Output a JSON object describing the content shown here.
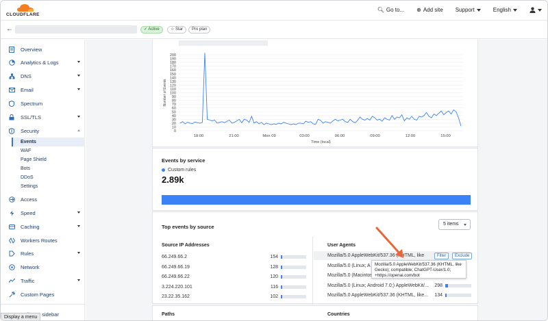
{
  "brand": {
    "name": "CLOUDFLARE",
    "accent": "#f38020",
    "link": "#1e3a66",
    "blue": "#3b82f6"
  },
  "topnav": {
    "goto": "Go to...",
    "add_site": "Add site",
    "support": "Support",
    "language": "English"
  },
  "zone": {
    "status": "Active",
    "star": "Star",
    "plan": "Pro plan"
  },
  "sidebar": {
    "items": [
      {
        "label": "Overview",
        "icon": "document-icon"
      },
      {
        "label": "Analytics & Logs",
        "icon": "analytics-icon"
      },
      {
        "label": "DNS",
        "icon": "dns-icon"
      },
      {
        "label": "Email",
        "icon": "email-icon"
      },
      {
        "label": "Spectrum",
        "icon": "shield-icon"
      },
      {
        "label": "SSL/TLS",
        "icon": "lock-icon"
      },
      {
        "label": "Security",
        "icon": "security-shield-icon"
      },
      {
        "label": "Access",
        "icon": "access-icon"
      },
      {
        "label": "Speed",
        "icon": "speed-icon"
      },
      {
        "label": "Caching",
        "icon": "caching-icon"
      },
      {
        "label": "Workers Routes",
        "icon": "workers-icon"
      },
      {
        "label": "Rules",
        "icon": "rules-icon"
      },
      {
        "label": "Network",
        "icon": "network-icon"
      },
      {
        "label": "Traffic",
        "icon": "traffic-icon"
      },
      {
        "label": "Custom Pages",
        "icon": "wrench-icon"
      }
    ],
    "security_sub": [
      "Events",
      "WAF",
      "Page Shield",
      "Bots",
      "DDoS",
      "Settings"
    ],
    "collapse": "Collapse sidebar"
  },
  "statusbar": "Display a menu",
  "chart_data": {
    "type": "line",
    "title": "",
    "xlabel": "Time (local)",
    "ylabel": "Number of Events",
    "ylim": [
      0,
      200
    ],
    "yticks": [
      0,
      10,
      20,
      30,
      40,
      50,
      60,
      70,
      80,
      90,
      100,
      110,
      120,
      130,
      140,
      150,
      160,
      170,
      180,
      190,
      200
    ],
    "xticks": [
      "18:00",
      "21:00",
      "Mon 09",
      "03:00",
      "06:00",
      "09:00",
      "12:00",
      "15:00"
    ],
    "series": [
      {
        "color": "#3b82f6",
        "values": [
          20,
          24,
          18,
          22,
          20,
          19,
          23,
          21,
          20,
          22,
          205,
          30,
          28,
          26,
          28,
          20,
          22,
          24,
          21,
          25,
          28,
          20,
          22,
          26,
          30,
          21,
          30,
          28,
          22,
          38,
          20,
          24,
          18,
          22,
          16,
          20,
          18,
          16,
          18,
          17,
          20,
          18,
          22,
          20,
          18,
          16,
          18,
          16,
          20,
          20,
          18,
          25,
          22,
          24,
          18,
          17,
          30,
          27,
          20,
          24,
          22,
          20,
          26,
          30,
          26,
          28,
          30,
          24,
          22,
          30,
          24,
          21,
          27,
          36,
          30,
          28,
          32,
          28,
          38,
          34,
          28,
          30,
          25,
          34,
          30,
          28,
          40,
          30,
          36,
          34,
          42,
          26,
          34,
          30,
          38,
          30,
          28,
          38,
          36,
          40,
          48,
          38,
          34,
          44,
          40,
          46,
          52,
          42,
          48,
          52,
          44,
          55,
          50,
          34,
          12
        ]
      }
    ]
  },
  "events_by_service": {
    "title": "Events by service",
    "legend": "Custom rules",
    "total": "2.89k"
  },
  "top_events": {
    "title": "Top events by source",
    "select": "5 items",
    "ip_header": "Source IP Addresses",
    "ips": [
      {
        "ip": "66.249.66.2",
        "count": 154,
        "frac": 0.04
      },
      {
        "ip": "66.249.66.19",
        "count": 128,
        "frac": 0.035
      },
      {
        "ip": "66.249.66.22",
        "count": 120,
        "frac": 0.033
      },
      {
        "ip": "3.224.220.101",
        "count": 116,
        "frac": 0.032
      },
      {
        "ip": "23.22.35.162",
        "count": 102,
        "frac": 0.03
      }
    ],
    "ua_header": "User Agents",
    "uas": [
      {
        "ua": "Mozilla/5.0 AppleWebKit/537.36 (KHTML, like",
        "count": "",
        "frac": 0
      },
      {
        "ua": "Mozilla/5.0 (Linux; A",
        "count": "",
        "frac": 0
      },
      {
        "ua": "Mozilla/5.0 (Macintos",
        "count": "",
        "frac": 0
      },
      {
        "ua": "Mozilla/5.0 (Linux; Android 7.0;) AppleWebKit/...",
        "count": "298",
        "frac": 0.08
      },
      {
        "ua": "Mozilla/5.0 AppleWebKit/537.36 (KHTML, like...",
        "count": "134",
        "frac": 0.04
      }
    ],
    "filter": "Filter",
    "exclude": "Exclude",
    "tooltip": "Mozilla/5.0 AppleWebKit/537.36 (KHTML, like Gecko); compatible; ChatGPT-User/1.0; +https://openai.com/bot",
    "paths_header": "Paths",
    "countries_header": "Countries"
  }
}
